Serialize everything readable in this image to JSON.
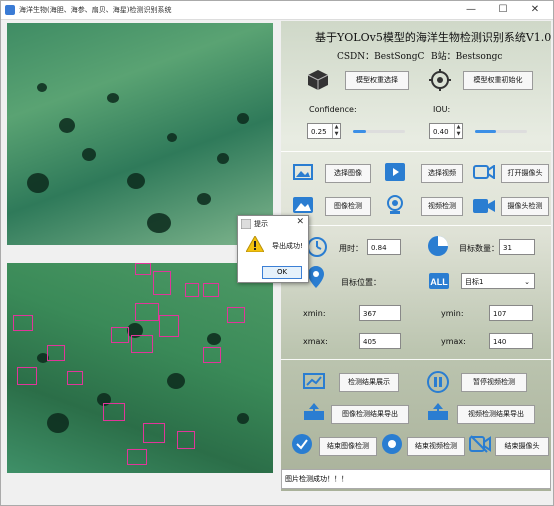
{
  "window": {
    "title": "海洋生物(海胆、海参、扇贝、海星)检测识别系统",
    "minimize": "—",
    "maximize": "☐",
    "close": "✕"
  },
  "header": {
    "title": "基于YOLOv5模型的海洋生物检测识别系统V1.0",
    "csdn": "CSDN：BestSongC",
    "bilibili": "B站：Bestsongc"
  },
  "model": {
    "select_label": "模型权重选择",
    "init_label": "模型权重初始化"
  },
  "params": {
    "confidence_label": "Confidence:",
    "confidence_value": "0.25",
    "confidence_fraction": 0.25,
    "iou_label": "IOU:",
    "iou_value": "0.40",
    "iou_fraction": 0.4
  },
  "source_buttons": {
    "select_image": "选择图像",
    "select_video": "选择视频",
    "open_camera": "打开摄像头",
    "image_detect": "图像检测",
    "video_detect": "视频检测",
    "camera_detect": "摄像头检测"
  },
  "stats": {
    "time_label": "用时：",
    "time_value": "0.84",
    "count_label": "目标数量：",
    "count_value": "31",
    "position_label": "目标位置：",
    "target_select": "目标1",
    "xmin_label": "xmin:",
    "xmin_value": "367",
    "ymin_label": "ymin:",
    "ymin_value": "107",
    "xmax_label": "xmax:",
    "xmax_value": "405",
    "ymax_label": "ymax:",
    "ymax_value": "140"
  },
  "actions": {
    "show_results": "检测结果展示",
    "pause_video": "暂停视频检测",
    "export_image": "图像检测结果导出",
    "export_video": "视频检测结果导出",
    "end_image": "结束图像检测",
    "end_video": "结束视频检测",
    "end_camera": "结束摄像头"
  },
  "status": {
    "message": "图片检测成功！！！"
  },
  "dialog": {
    "title": "提示",
    "message": "导出成功!",
    "ok": "OK",
    "close": "✕"
  },
  "colors": {
    "accent": "#3b8fe6",
    "detection_box": "#e0369a",
    "warning": "#f4c20d"
  }
}
